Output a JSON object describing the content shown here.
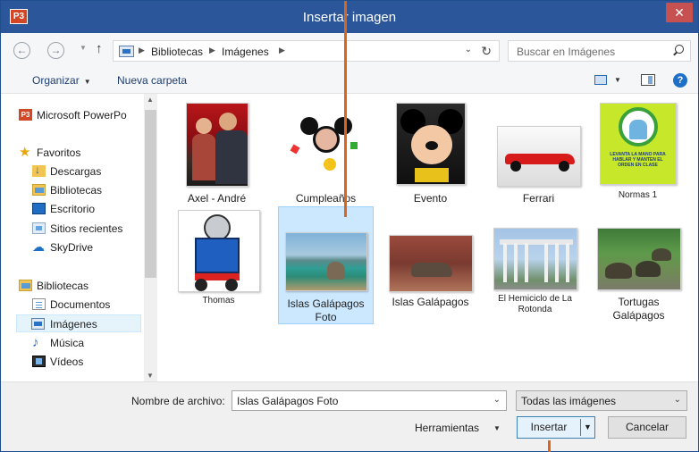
{
  "window": {
    "title": "Insertar imagen",
    "app_icon": "P3",
    "close_label": "✕"
  },
  "address": {
    "crumbs": [
      "Bibliotecas",
      "Imágenes"
    ],
    "search_placeholder": "Buscar en Imágenes"
  },
  "toolbar": {
    "organize": "Organizar",
    "new_folder": "Nueva carpeta"
  },
  "navpane": {
    "top_item": "Microsoft PowerPo",
    "favorites_header": "Favoritos",
    "favorites": [
      "Descargas",
      "Bibliotecas",
      "Escritorio",
      "Sitios recientes",
      "SkyDrive"
    ],
    "libraries_header": "Bibliotecas",
    "libraries": [
      "Documentos",
      "Imágenes",
      "Música",
      "Vídeos"
    ]
  },
  "files": [
    {
      "name": "Axel - André",
      "icon": "photo"
    },
    {
      "name": "Cumpleaños",
      "icon": "photo"
    },
    {
      "name": "Evento",
      "icon": "photo"
    },
    {
      "name": "Ferrari",
      "icon": "photo"
    },
    {
      "name": "Normas 1",
      "icon": "photo"
    },
    {
      "name": "Thomas",
      "icon": "photo"
    },
    {
      "name": "Islas Galápagos Foto",
      "icon": "photo",
      "selected": true
    },
    {
      "name": "Islas Galápagos",
      "icon": "photo"
    },
    {
      "name": "El Hemiciclo de La Rotonda",
      "icon": "photo"
    },
    {
      "name": "Tortugas Galápagos",
      "icon": "photo"
    }
  ],
  "normas_thumb_text": "LEVANTA LA MANO PARA HABLAR Y MANTEN EL ORDEN EN CLASE",
  "bottom": {
    "filename_label": "Nombre de archivo:",
    "filename_value": "Islas Galápagos Foto",
    "filter_value": "Todas las imágenes",
    "tools_label": "Herramientas",
    "insert_label": "Insertar",
    "cancel_label": "Cancelar"
  },
  "colors": {
    "titlebar": "#2b579a",
    "callout": "#d9661b",
    "selection": "#cce8ff"
  }
}
